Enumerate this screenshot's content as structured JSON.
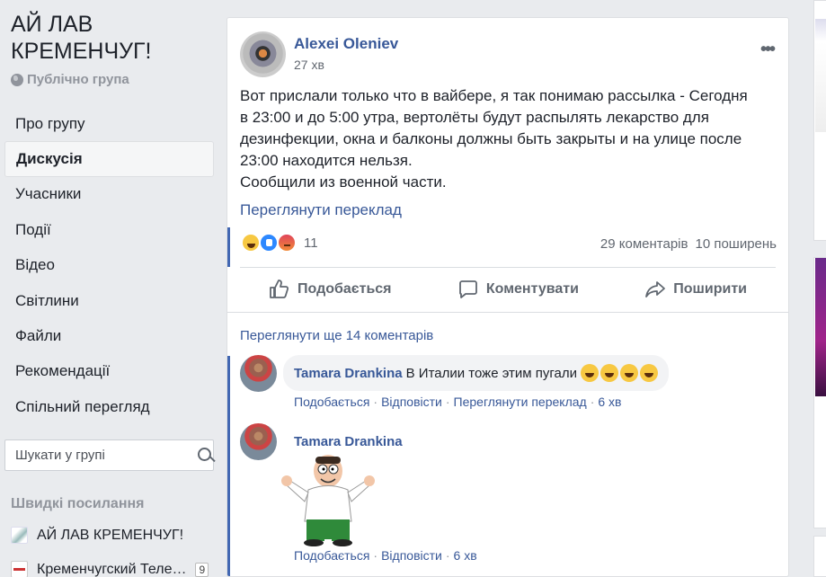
{
  "group": {
    "title": "АЙ ЛАВ КРЕМЕНЧУГ!",
    "privacy": "Публічно група"
  },
  "nav": {
    "items": [
      {
        "label": "Про групу"
      },
      {
        "label": "Дискусія",
        "active": true
      },
      {
        "label": "Учасники"
      },
      {
        "label": "Події"
      },
      {
        "label": "Відео"
      },
      {
        "label": "Світлини"
      },
      {
        "label": "Файли"
      },
      {
        "label": "Рекомендації"
      },
      {
        "label": "Спільний перегляд"
      }
    ]
  },
  "search": {
    "placeholder": "Шукати у групі"
  },
  "quick_links": {
    "title": "Швидкі посилання",
    "items": [
      {
        "label": "АЙ ЛАВ КРЕМЕНЧУГ!"
      },
      {
        "label": "Кременчугский Теле…",
        "count": "9"
      }
    ]
  },
  "post": {
    "author": "Alexei Oleniev",
    "time": "27 хв",
    "text_lines": [
      "Вот прислали только что в вайбере, я так понимаю рассылка - Сегодня",
      "в 23:00 и до 5:00 утра, вертолёты будут распылять лекарство для",
      "дезинфекции, окна и балконы должны быть закрыты и на улице после",
      "23:00 находится нельзя.",
      "Сообщили из военной части."
    ],
    "see_translation": "Переглянути переклад",
    "reaction_count": "11",
    "comments_count": "29 коментарів",
    "shares_count": "10 поширень",
    "actions": {
      "like": "Подобається",
      "comment": "Коментувати",
      "share": "Поширити"
    }
  },
  "comments": {
    "view_more": "Переглянути ще 14 коментарів",
    "items": [
      {
        "author": "Tamara Drankina",
        "text": "В Италии тоже этим пугали",
        "like": "Подобається",
        "reply": "Відповісти",
        "translate": "Переглянути переклад",
        "time": "6 хв"
      },
      {
        "author": "Tamara Drankina",
        "like": "Подобається",
        "reply": "Відповісти",
        "time": "6 хв"
      }
    ]
  },
  "colors": {
    "link": "#385898",
    "accent": "#4267b2",
    "bg": "#e9ebee"
  }
}
